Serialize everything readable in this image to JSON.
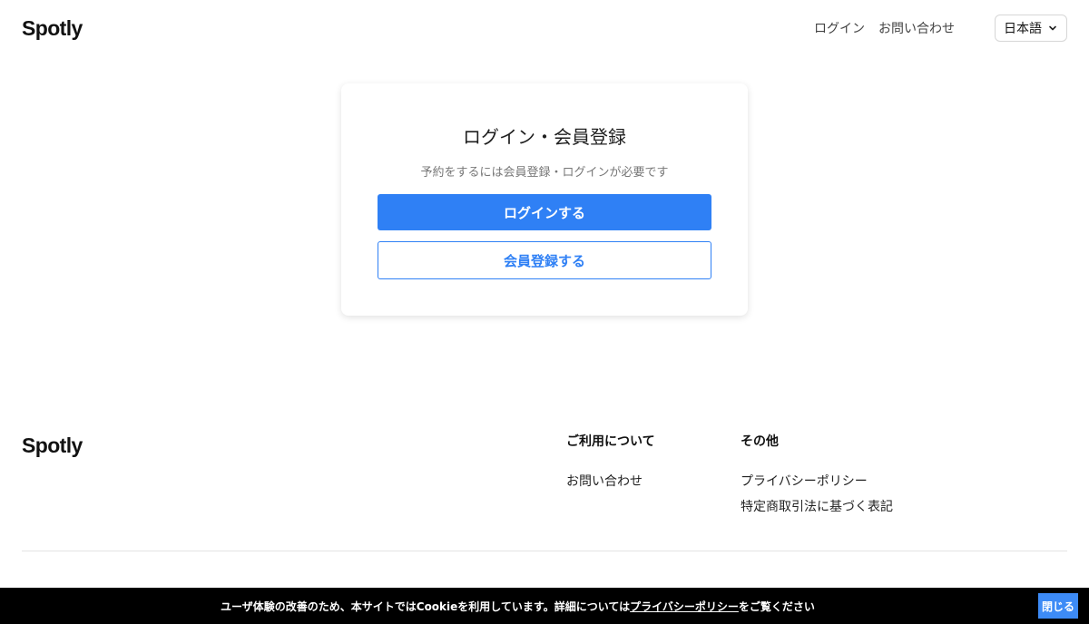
{
  "header": {
    "logo": "Spotly",
    "nav": {
      "login": "ログイン",
      "contact": "お問い合わせ"
    },
    "language": {
      "selected": "日本語",
      "icon": "chevron-down-icon"
    }
  },
  "auth_card": {
    "title": "ログイン・会員登録",
    "subtitle": "予約をするには会員登録・ログインが必要です",
    "login_button": "ログインする",
    "register_button": "会員登録する"
  },
  "footer": {
    "logo": "Spotly",
    "columns": [
      {
        "heading": "ご利用について",
        "links": [
          "お問い合わせ"
        ]
      },
      {
        "heading": "その他",
        "links": [
          "プライバシーポリシー",
          "特定商取引法に基づく表記"
        ]
      }
    ]
  },
  "cookie_bar": {
    "text_before": "ユーザ体験の改善のため、本サイトではCookieを利用しています。詳細については",
    "link": "プライバシーポリシー",
    "text_after": "をご覧ください",
    "close_button": "閉じる"
  },
  "colors": {
    "primary": "#2f80f5",
    "cookie_bar_bg": "#000000",
    "close_button_bg": "#3d8bf6"
  }
}
